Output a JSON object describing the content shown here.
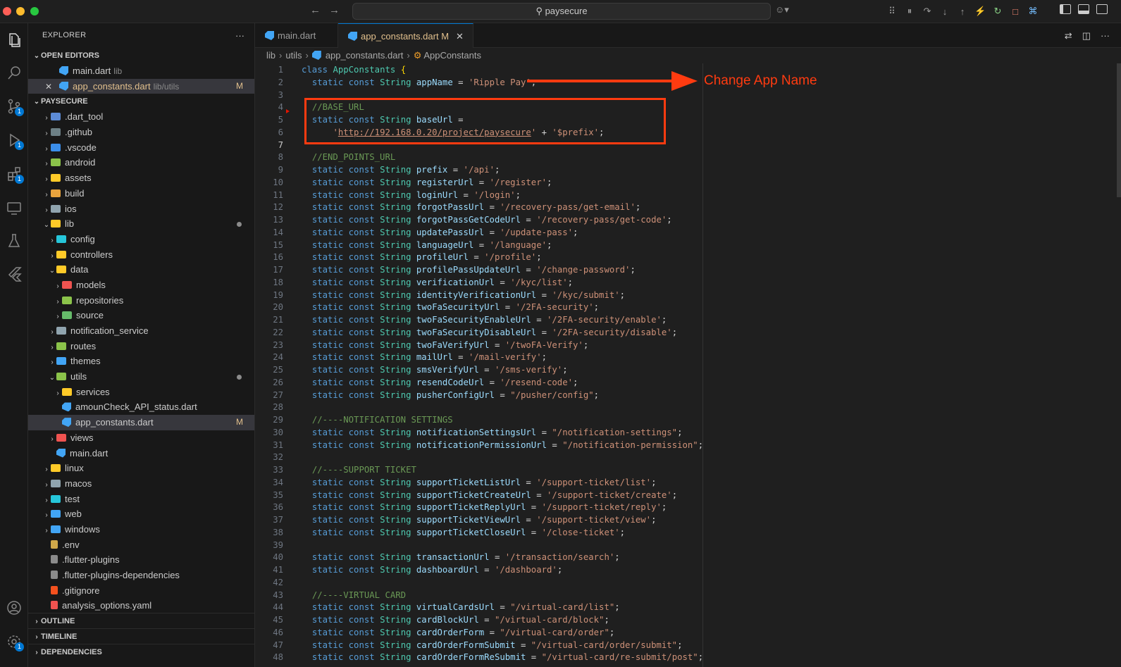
{
  "titlebar": {
    "search": "paysecure"
  },
  "explorer": {
    "title": "EXPLORER",
    "more": "···"
  },
  "open_editors": {
    "title": "OPEN EDITORS",
    "items": [
      {
        "name": "main.dart",
        "desc": "lib"
      },
      {
        "name": "app_constants.dart",
        "desc": "lib/utils",
        "status": "M"
      }
    ]
  },
  "project": {
    "title": "PAYSECURE"
  },
  "tree": [
    {
      "name": ".dart_tool"
    },
    {
      "name": ".github"
    },
    {
      "name": ".vscode"
    },
    {
      "name": "android"
    },
    {
      "name": "assets"
    },
    {
      "name": "build"
    },
    {
      "name": "ios"
    },
    {
      "name": "lib"
    },
    {
      "name": "config"
    },
    {
      "name": "controllers"
    },
    {
      "name": "data"
    },
    {
      "name": "models"
    },
    {
      "name": "repositories"
    },
    {
      "name": "source"
    },
    {
      "name": "notification_service"
    },
    {
      "name": "routes"
    },
    {
      "name": "themes"
    },
    {
      "name": "utils"
    },
    {
      "name": "services"
    },
    {
      "name": "amounCheck_API_status.dart"
    },
    {
      "name": "app_constants.dart",
      "status": "M"
    },
    {
      "name": "views"
    },
    {
      "name": "main.dart"
    },
    {
      "name": "linux"
    },
    {
      "name": "macos"
    },
    {
      "name": "test"
    },
    {
      "name": "web"
    },
    {
      "name": "windows"
    },
    {
      "name": ".env"
    },
    {
      "name": ".flutter-plugins"
    },
    {
      "name": ".flutter-plugins-dependencies"
    },
    {
      "name": ".gitignore"
    },
    {
      "name": "analysis_options.yaml"
    }
  ],
  "panels": {
    "outline": "OUTLINE",
    "timeline": "TIMELINE",
    "dependencies": "DEPENDENCIES"
  },
  "activity_badges": {
    "scm": "1",
    "run": "1",
    "extensions": "1",
    "settings": "1"
  },
  "tabs": [
    {
      "label": "main.dart"
    },
    {
      "label": "app_constants.dart",
      "status": "M"
    }
  ],
  "breadcrumb": [
    "lib",
    "utils",
    "app_constants.dart",
    "AppConstants"
  ],
  "annotation": "Change App Name",
  "current_line": "7",
  "code": [
    "class AppConstants {",
    "  static const String appName = 'Ripple Pay';",
    "",
    "  //BASE_URL",
    "  static const String baseUrl =",
    "      'http://192.168.0.20/project/paysecure' + '$prefix';",
    "",
    "  //END_POINTS_URL",
    "  static const String prefix = '/api';",
    "  static const String registerUrl = '/register';",
    "  static const String loginUrl = '/login';",
    "  static const String forgotPassUrl = '/recovery-pass/get-email';",
    "  static const String forgotPassGetCodeUrl = '/recovery-pass/get-code';",
    "  static const String updatePassUrl = '/update-pass';",
    "  static const String languageUrl = '/language';",
    "  static const String profileUrl = '/profile';",
    "  static const String profilePassUpdateUrl = '/change-password';",
    "  static const String verificationUrl = '/kyc/list';",
    "  static const String identityVerificationUrl = '/kyc/submit';",
    "  static const String twoFaSecurityUrl = '/2FA-security';",
    "  static const String twoFaSecurityEnableUrl = '/2FA-security/enable';",
    "  static const String twoFaSecurityDisableUrl = '/2FA-security/disable';",
    "  static const String twoFaVerifyUrl = '/twoFA-Verify';",
    "  static const String mailUrl = '/mail-verify';",
    "  static const String smsVerifyUrl = '/sms-verify';",
    "  static const String resendCodeUrl = '/resend-code';",
    "  static const String pusherConfigUrl = \"/pusher/config\";",
    "",
    "  //----NOTIFICATION SETTINGS",
    "  static const String notificationSettingsUrl = \"/notification-settings\";",
    "  static const String notificationPermissionUrl = \"/notification-permission\";",
    "",
    "  //----SUPPORT TICKET",
    "  static const String supportTicketListUrl = '/support-ticket/list';",
    "  static const String supportTicketCreateUrl = '/support-ticket/create';",
    "  static const String supportTicketReplyUrl = '/support-ticket/reply';",
    "  static const String supportTicketViewUrl = '/support-ticket/view';",
    "  static const String supportTicketCloseUrl = '/close-ticket';",
    "",
    "  static const String transactionUrl = '/transaction/search';",
    "  static const String dashboardUrl = '/dashboard';",
    "",
    "  //----VIRTUAL CARD",
    "  static const String virtualCardsUrl = \"/virtual-card/list\";",
    "  static const String cardBlockUrl = \"/virtual-card/block\";",
    "  static const String cardOrderForm = \"/virtual-card/order\";",
    "  static const String cardOrderFormSubmit = \"/virtual-card/order/submit\";",
    "  static const String cardOrderFormReSubmit = \"/virtual-card/re-submit/post\";"
  ]
}
